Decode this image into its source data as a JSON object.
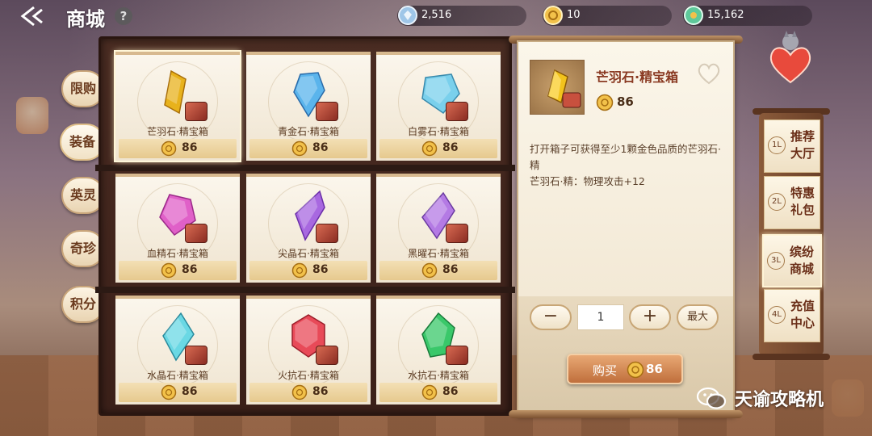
{
  "header": {
    "title": "商城",
    "help_label": "?",
    "currencies": [
      {
        "icon": "diamond-currency-icon",
        "value": "2,516"
      },
      {
        "icon": "gold-coupon-icon",
        "value": "10"
      },
      {
        "icon": "jade-currency-icon",
        "value": "15,162"
      }
    ]
  },
  "side_tabs": [
    {
      "label": "限购",
      "active": false
    },
    {
      "label": "装备",
      "active": true
    },
    {
      "label": "英灵",
      "active": false
    },
    {
      "label": "奇珍",
      "active": false
    },
    {
      "label": "积分",
      "active": false
    }
  ],
  "items": [
    {
      "name": "芒羽石·精宝箱",
      "price": "86",
      "gem_color": "#e8b21c",
      "gem_shade": "#a86e08",
      "selected": true
    },
    {
      "name": "青金石·精宝箱",
      "price": "86",
      "gem_color": "#5ab4ec",
      "gem_shade": "#2a6aa8",
      "selected": false
    },
    {
      "name": "白雾石·精宝箱",
      "price": "86",
      "gem_color": "#7ad0ec",
      "gem_shade": "#3a8aac",
      "selected": false
    },
    {
      "name": "血精石·精宝箱",
      "price": "86",
      "gem_color": "#e060c8",
      "gem_shade": "#9a2a88",
      "selected": false
    },
    {
      "name": "尖晶石·精宝箱",
      "price": "86",
      "gem_color": "#a868e0",
      "gem_shade": "#6a2ea8",
      "selected": false
    },
    {
      "name": "黑曜石·精宝箱",
      "price": "86",
      "gem_color": "#b47ae4",
      "gem_shade": "#6a3aa0",
      "selected": false
    },
    {
      "name": "水晶石·精宝箱",
      "price": "86",
      "gem_color": "#6ad8e4",
      "gem_shade": "#2a8a9c",
      "selected": false
    },
    {
      "name": "火抗石·精宝箱",
      "price": "86",
      "gem_color": "#e84a58",
      "gem_shade": "#9a1e2a",
      "selected": false
    },
    {
      "name": "水抗石·精宝箱",
      "price": "86",
      "gem_color": "#3ac86a",
      "gem_shade": "#1a7a3a",
      "selected": false
    }
  ],
  "detail": {
    "name": "芒羽石·精宝箱",
    "price": "86",
    "description": "打开箱子可获得至少1颗金色品质的芒羽石·精",
    "stat": "芒羽石·精：物理攻击+12",
    "quantity": "1",
    "minus_label": "−",
    "plus_label": "+",
    "max_label": "最大",
    "buy_label": "购买",
    "buy_price": "86"
  },
  "right_nav": [
    {
      "badge": "1L",
      "label": "推荐大厅",
      "active": false
    },
    {
      "badge": "2L",
      "label": "特惠礼包",
      "active": false
    },
    {
      "badge": "3L",
      "label": "缤纷商城",
      "active": true
    },
    {
      "badge": "4L",
      "label": "充值中心",
      "active": false
    }
  ],
  "watermark": {
    "text": "天谕攻略机"
  },
  "colors": {
    "accent": "#c06f3c",
    "panel": "#fbf6ea",
    "shelf": "#3b2019"
  }
}
